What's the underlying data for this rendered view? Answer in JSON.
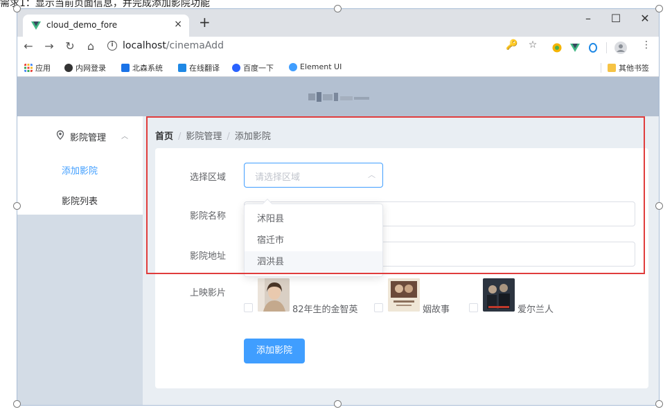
{
  "document": {
    "caption_text": "需求1：显示当前页面信息，并完成添加影院功能"
  },
  "browser": {
    "tab_title": "cloud_demo_fore",
    "tab_close": "×",
    "new_tab": "+",
    "window_controls": {
      "minimize": "–",
      "maximize": "☐",
      "close": "✕"
    },
    "nav": {
      "back": "←",
      "forward": "→",
      "reload": "↻",
      "home": "⌂"
    },
    "address": {
      "host": "localhost",
      "path": "/cinemaAdd"
    },
    "toolbar_icons": {
      "key": "🔑",
      "star": "☆",
      "menu": "⋮"
    },
    "bookmarks": [
      {
        "label": "应用",
        "icon": "apps-grid-icon",
        "color": "#e8453c"
      },
      {
        "label": "内网登录",
        "icon": "globe-icon",
        "color": "#333333"
      },
      {
        "label": "北森系统",
        "icon": "beisen-icon",
        "color": "#1a73e8"
      },
      {
        "label": "在线翻译",
        "icon": "translate-icon",
        "color": "#1e88e5"
      },
      {
        "label": "百度一下",
        "icon": "baidu-icon",
        "color": "#2962ff"
      },
      {
        "label": "Element UI",
        "icon": "element-icon",
        "color": "#409eff"
      }
    ],
    "other_bookmarks": "其他书签"
  },
  "app": {
    "sidebar": {
      "group_label": "影院管理",
      "items": [
        {
          "label": "添加影院",
          "active": true
        },
        {
          "label": "影院列表",
          "active": false
        }
      ]
    },
    "breadcrumb": {
      "home": "首页",
      "section": "影院管理",
      "current": "添加影院",
      "separator": "/"
    },
    "form": {
      "region_label": "选择区域",
      "region_placeholder": "请选择区域",
      "name_label": "影院名称",
      "address_label": "影院地址",
      "films_label": "上映影片",
      "region_options": [
        "沭阳县",
        "宿迁市",
        "泗洪县"
      ],
      "hovered_option": "泗洪县",
      "films": [
        {
          "name": "82年生的金智英",
          "checked": false
        },
        {
          "name": "姻故事",
          "checked": false
        },
        {
          "name": "爱尔兰人",
          "checked": false
        }
      ],
      "submit_label": "添加影院"
    }
  },
  "colors": {
    "primary": "#409eff",
    "header_bg": "#b3c0d1",
    "sidebar_bg": "#d3dce6",
    "main_bg": "#e9eef3",
    "annotation_red": "#e03c3c"
  }
}
